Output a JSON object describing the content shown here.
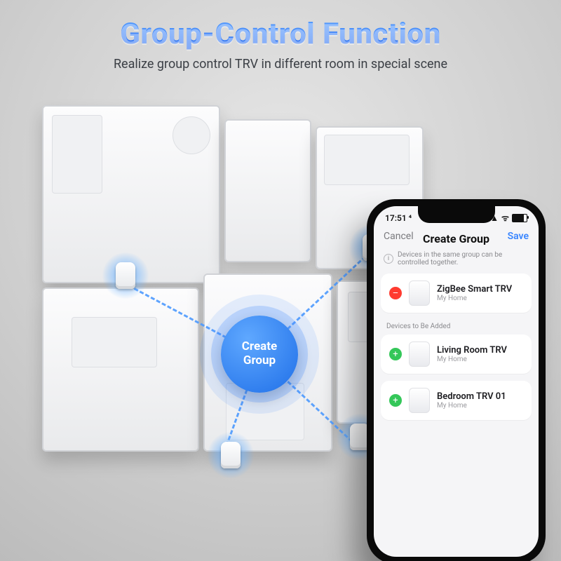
{
  "heading": {
    "title": "Group-Control Function",
    "subtitle": "Realize group control TRV in different room in special scene"
  },
  "hub_label": "Create\nGroup",
  "phone": {
    "status_time": "17:51 ⁴",
    "nav": {
      "cancel": "Cancel",
      "title": "Create Group",
      "save": "Save"
    },
    "hint": "Devices in the same group can be controlled together.",
    "selected": [
      {
        "name": "ZigBee Smart TRV",
        "home": "My Home"
      }
    ],
    "to_add_label": "Devices to Be Added",
    "to_add": [
      {
        "name": "Living Room TRV",
        "home": "My Home"
      },
      {
        "name": "Bedroom TRV 01",
        "home": "My Home"
      }
    ]
  }
}
